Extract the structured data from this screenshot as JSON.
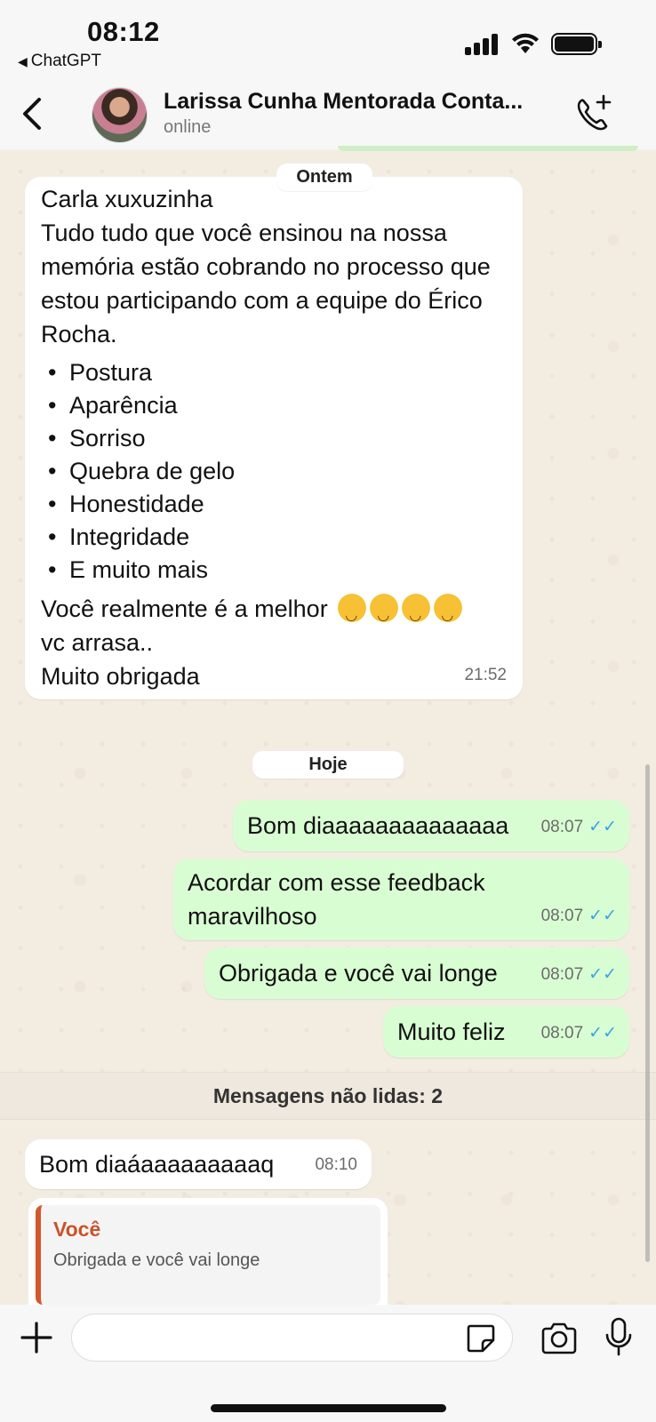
{
  "status_bar": {
    "time": "08:12",
    "back_app": "ChatGPT"
  },
  "header": {
    "contact_name": "Larissa Cunha Mentorada Conta...",
    "contact_status": "online"
  },
  "chat": {
    "date_yesterday": "Ontem",
    "big_message": {
      "lines": [
        "Carla xuxuzinha",
        "Tudo tudo que você ensinou na nossa memória estão cobrando no processo que estou participando com a equipe do Érico Rocha."
      ],
      "bullets": [
        "Postura",
        "Aparência",
        "Sorriso",
        "Quebra de gelo",
        "Honestidade",
        "Integridade",
        "E muito mais"
      ],
      "closing_1": "Você realmente é a melhor",
      "emojis": [
        "smiling-face-emoji",
        "smiling-face-emoji",
        "smiling-face-emoji",
        "smiling-face-emoji"
      ],
      "closing_2": "vc arrasa..",
      "closing_3": "Muito obrigada",
      "time": "21:52"
    },
    "date_today": "Hoje",
    "outgoing": [
      {
        "text": "Bom diaaaaaaaaaaaaaa",
        "time": "08:07"
      },
      {
        "text": "Acordar com esse feedback maravilhoso",
        "time": "08:07"
      },
      {
        "text": "Obrigada e você vai longe",
        "time": "08:07"
      },
      {
        "text": "Muito feliz",
        "time": "08:07"
      }
    ],
    "unread_banner": "Mensagens não lidas: 2",
    "incoming_last": {
      "text": "Bom diaáaaaaaaaaaq",
      "time": "08:10"
    },
    "quoted": {
      "name": "Você",
      "text": "Obrigada e você vai longe"
    },
    "colors": {
      "outgoing_bubble": "#d9fdd3",
      "incoming_bubble": "#ffffff",
      "read_ticks": "#38a3e5",
      "quote_accent": "#d3572a"
    }
  },
  "composer": {
    "placeholder": ""
  }
}
